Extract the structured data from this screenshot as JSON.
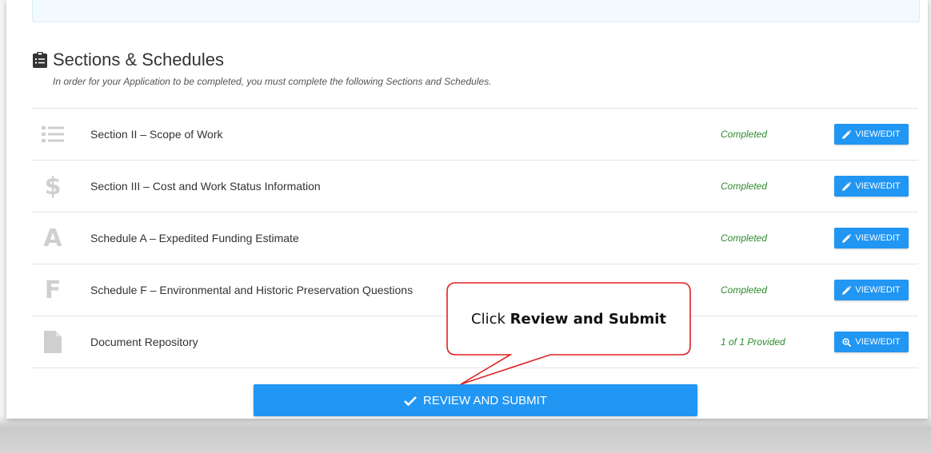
{
  "heading": {
    "title": "Sections & Schedules",
    "subtitle": "In order for your Application to be completed, you must complete the following Sections and Schedules."
  },
  "rows": [
    {
      "label": "Section II – Scope of Work",
      "status": "Completed",
      "button": "VIEW/EDIT",
      "icon": "list-icon"
    },
    {
      "label": "Section III – Cost and Work Status Information",
      "status": "Completed",
      "button": "VIEW/EDIT",
      "icon": "dollar-icon"
    },
    {
      "label": "Schedule A – Expedited Funding Estimate",
      "status": "Completed",
      "button": "VIEW/EDIT",
      "icon": "letter-a-icon",
      "glyph": "A"
    },
    {
      "label": "Schedule F – Environmental and Historic Preservation Questions",
      "status": "Completed",
      "button": "VIEW/EDIT",
      "icon": "letter-f-icon",
      "glyph": "F"
    },
    {
      "label": "Document Repository",
      "status": "1 of 1 Provided",
      "button": "VIEW/EDIT",
      "icon": "document-icon"
    }
  ],
  "submit_label": "REVIEW AND SUBMIT",
  "callout": {
    "prefix": "Click ",
    "emphasis": "Review and Submit"
  },
  "colors": {
    "accent": "#2196f3",
    "status_green": "#2e8b2e",
    "callout_border": "#e02020"
  }
}
